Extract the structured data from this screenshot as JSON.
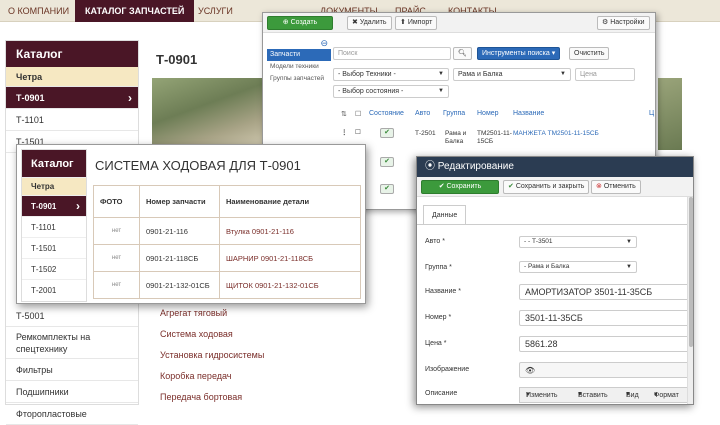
{
  "topnav": {
    "items": [
      "О КОМПАНИИ",
      "КАТАЛОГ ЗАПЧАСТЕЙ",
      "УСЛУГИ",
      "ДОКУМЕНТЫ",
      "ПРАЙС",
      "КОНТАКТЫ"
    ],
    "active_index": 1
  },
  "site_sidebar": {
    "title": "Каталог",
    "category": "Четра",
    "items": [
      "Т-0901",
      "Т-1101",
      "Т-1501",
      "Т-5001",
      "Ремкомплекты на спецтехнику",
      "Фильтры",
      "Подшипники",
      "Фторопластовые"
    ],
    "selected": "Т-0901"
  },
  "page": {
    "title": "Т-0901",
    "links": [
      "Агрегат тяговый",
      "Система ходовая",
      "Установка гидросистемы",
      "Коробка передач",
      "Передача бортовая"
    ]
  },
  "admin_list": {
    "toolbar": {
      "create": "Создать",
      "delete": "Удалить",
      "import": "Импорт",
      "settings": "Настройки"
    },
    "sidebar": {
      "active": "Запчасти",
      "items": [
        "Модели техники",
        "Группы запчастей"
      ]
    },
    "search_placeholder": "Поиск",
    "search_tools": "Инструменты поиска",
    "clear": "Очистить",
    "filters": {
      "tech": "- Выбор Техники -",
      "group": "Рама и Балка",
      "price_placeholder": "Цена",
      "state": "- Выбор состояния -"
    },
    "columns": [
      "Состояние",
      "Авто",
      "Группа",
      "Номер",
      "Название"
    ],
    "row": {
      "auto": "Т-2501",
      "group": "Рама и Балка",
      "number": "ТМ2501-11-15СБ",
      "name": "МАНЖЕТА ТМ2501-11-15СБ"
    },
    "extra_col_hint": "Ц"
  },
  "catalog_window": {
    "sidebar_title": "Каталог",
    "category": "Четра",
    "items": [
      "Т-0901",
      "Т-1101",
      "Т-1501",
      "Т-1502",
      "Т-2001"
    ],
    "selected": "Т-0901",
    "title": "СИСТЕМА ХОДОВАЯ ДЛЯ Т-0901",
    "table": {
      "headers": [
        "ФОТО",
        "Номер запчасти",
        "Наименование детали"
      ],
      "rows": [
        {
          "photo": "нет",
          "number": "0901-21-116",
          "name": "Втулка 0901-21-116"
        },
        {
          "photo": "нет",
          "number": "0901-21-118СБ",
          "name": "ШАРНИР 0901-21-118СБ"
        },
        {
          "photo": "нет",
          "number": "0901-21-132-01СБ",
          "name": "ЩИТОК 0901-21-132-01СБ"
        }
      ]
    }
  },
  "edit_window": {
    "title": "Редактирование",
    "save": "Сохранить",
    "save_close": "Сохранить и закрыть",
    "cancel": "Отменить",
    "tab": "Данные",
    "fields": [
      {
        "label": "Авто *",
        "value": "- - Т-3501"
      },
      {
        "label": "Группа *",
        "value": "- Рама и Балка"
      },
      {
        "label": "Название *",
        "value": "АМОРТИЗАТОР 3501-11-35СБ"
      },
      {
        "label": "Номер *",
        "value": "3501-11-35СБ"
      },
      {
        "label": "Цена *",
        "value": "5861.28"
      },
      {
        "label": "Изображение",
        "value": ""
      },
      {
        "label": "Описание",
        "value": ""
      }
    ],
    "editor_menu": [
      "Изменить",
      "Вставить",
      "Вид",
      "Формат"
    ]
  }
}
